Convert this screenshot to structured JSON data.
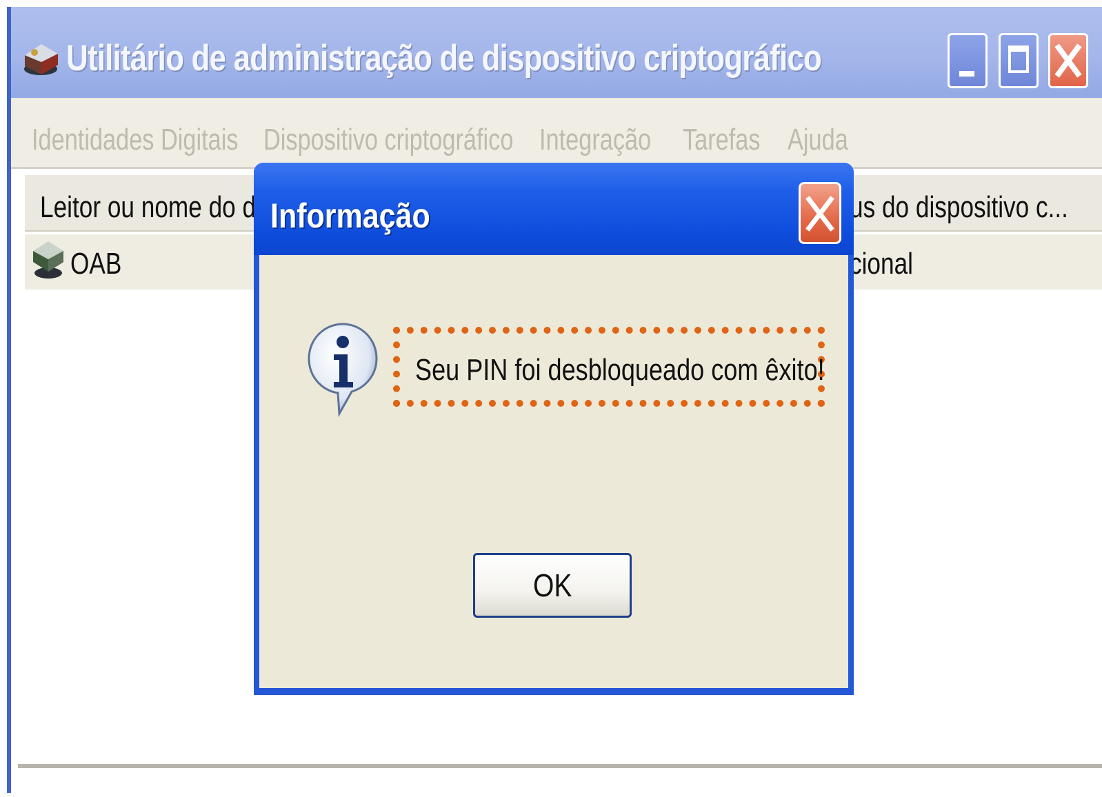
{
  "window": {
    "title": "Utilitário de administração de dispositivo criptográfico",
    "icons": {
      "app": "crypto-device-icon",
      "minimize": "minimize-icon",
      "maximize": "maximize-icon",
      "close": "close-icon"
    }
  },
  "menu": {
    "items": [
      {
        "label": "Identidades Digitais"
      },
      {
        "label": "Dispositivo criptográfico"
      },
      {
        "label": "Integração"
      },
      {
        "label": "Tarefas"
      },
      {
        "label": "Ajuda"
      }
    ]
  },
  "list": {
    "columns": [
      {
        "label": "Leitor ou nome do di"
      },
      {
        "label": "us do dispositivo c..."
      }
    ],
    "rows": [
      {
        "name": "OAB",
        "status": "cional",
        "icon": "smart-card-icon"
      }
    ]
  },
  "dialog": {
    "title": "Informação",
    "message": "Seu PIN foi desbloqueado com êxito!",
    "ok_label": "OK",
    "icon": "info-icon",
    "highlight_color": "#df6414"
  },
  "colors": {
    "titlebar_inactive": "#a4b6ea",
    "dialog_titlebar": "#0f4ddd",
    "dialog_body": "#ece9d8"
  }
}
